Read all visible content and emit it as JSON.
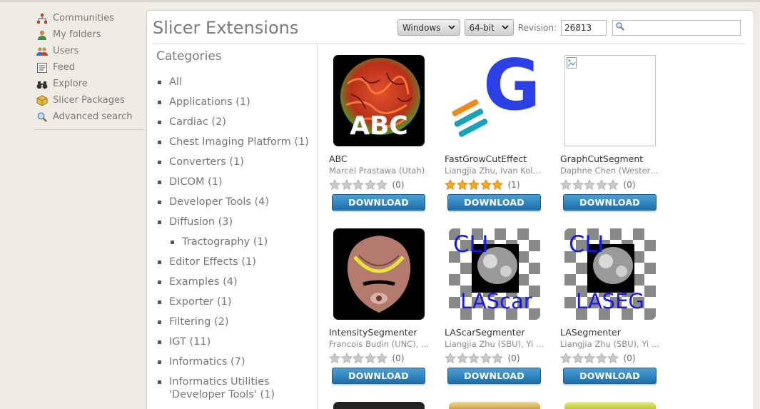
{
  "nav": {
    "items": [
      {
        "label": "Communities",
        "icon": "communities-icon"
      },
      {
        "label": "My folders",
        "icon": "user-folder-icon"
      },
      {
        "label": "Users",
        "icon": "users-icon"
      },
      {
        "label": "Feed",
        "icon": "feed-icon"
      },
      {
        "label": "Explore",
        "icon": "binoculars-icon"
      },
      {
        "label": "Slicer Packages",
        "icon": "package-icon"
      },
      {
        "label": "Advanced search",
        "icon": "magnifier-icon"
      }
    ]
  },
  "header": {
    "title": "Slicer Extensions",
    "os_select": "Windows",
    "arch_select": "64-bit",
    "revision_label": "Revision:",
    "revision_value": "26813",
    "search_placeholder": ""
  },
  "categories": {
    "title": "Categories",
    "items": [
      {
        "label": "All"
      },
      {
        "label": "Applications (1)"
      },
      {
        "label": "Cardiac (2)"
      },
      {
        "label": "Chest Imaging Platform (1)"
      },
      {
        "label": "Converters (1)"
      },
      {
        "label": "DICOM (1)"
      },
      {
        "label": "Developer Tools (4)"
      },
      {
        "label": "Diffusion (3)"
      },
      {
        "label": "Tractography (1)",
        "sub": true
      },
      {
        "label": "Editor Effects (1)"
      },
      {
        "label": "Examples (4)"
      },
      {
        "label": "Exporter (1)"
      },
      {
        "label": "Filtering (2)"
      },
      {
        "label": "IGT (11)"
      },
      {
        "label": "Informatics (7)"
      },
      {
        "label": "Informatics Utilities 'Developer Tools' (1)"
      }
    ]
  },
  "extensions": [
    {
      "name": "ABC",
      "author": "Marcel Prastawa (Utah)",
      "rating": 0,
      "rating_count": "(0)",
      "download": "DOWNLOAD",
      "thumb_text": "ABC"
    },
    {
      "name": "FastGrowCutEffect",
      "author": "Liangjia Zhu, Ivan Kolesov",
      "rating": 5,
      "rating_count": "(1)",
      "download": "DOWNLOAD",
      "thumb_text": "G"
    },
    {
      "name": "GraphCutSegment",
      "author": "Daphne Chen (Western University)",
      "rating": 0,
      "rating_count": "(0)",
      "download": "DOWNLOAD",
      "thumb_text": ""
    },
    {
      "name": "IntensitySegmenter",
      "author": "Francois Budin (UNC), ...",
      "rating": 0,
      "rating_count": "(0)",
      "download": "DOWNLOAD",
      "thumb_text": ""
    },
    {
      "name": "LAScarSegmenter",
      "author": "Liangjia Zhu (SBU), Yi Gao",
      "rating": 0,
      "rating_count": "(0)",
      "download": "DOWNLOAD",
      "thumb_text_top": "CLI",
      "thumb_text_bottom": "LAScar"
    },
    {
      "name": "LASegmenter",
      "author": "Liangjia Zhu (SBU), Yi Gao",
      "rating": 0,
      "rating_count": "(0)",
      "download": "DOWNLOAD",
      "thumb_text_top": "CLI",
      "thumb_text_bottom": "LASEG"
    }
  ],
  "colors": {
    "download_button": "#2a7fbf",
    "star_filled": "#f5a81c",
    "star_empty": "#c9c9c9",
    "title_text": "#7b7b7b"
  }
}
